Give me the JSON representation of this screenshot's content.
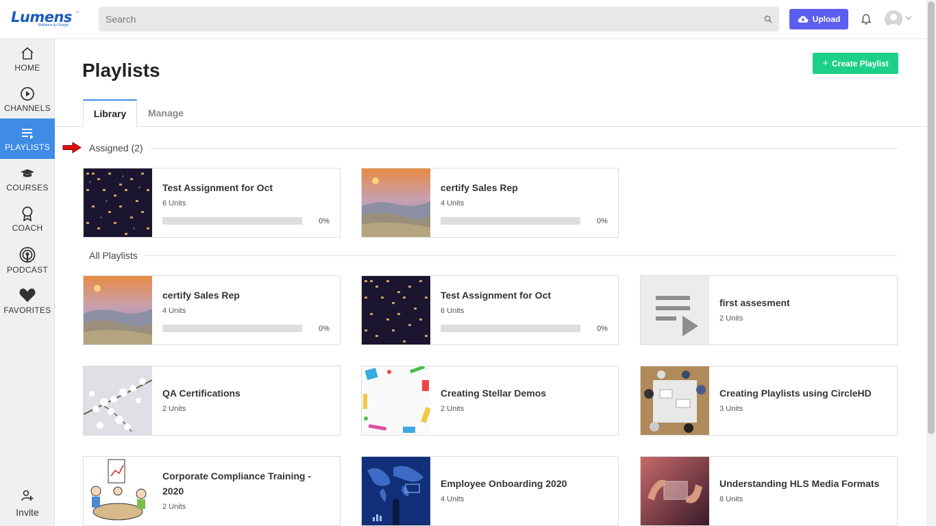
{
  "header": {
    "logo_text": "Lumens",
    "logo_tagline": "Brilliance by Design",
    "logo_tm": "™",
    "search_placeholder": "Search",
    "upload_label": "Upload"
  },
  "sidebar": {
    "items": [
      {
        "label": "HOME",
        "icon": "home-icon"
      },
      {
        "label": "CHANNELS",
        "icon": "play-circle-icon"
      },
      {
        "label": "PLAYLISTS",
        "icon": "playlist-icon",
        "active": true
      },
      {
        "label": "COURSES",
        "icon": "graduation-cap-icon"
      },
      {
        "label": "COACH",
        "icon": "award-icon"
      },
      {
        "label": "PODCAST",
        "icon": "podcast-icon"
      },
      {
        "label": "FAVORITES",
        "icon": "heart-icon"
      }
    ],
    "invite_label": "Invite"
  },
  "page": {
    "title": "Playlists",
    "create_label": "Create Playlist",
    "tabs": [
      "Library",
      "Manage"
    ],
    "assigned_heading": "Assigned (2)",
    "all_heading": "All Playlists"
  },
  "assigned": [
    {
      "title": "Test Assignment for Oct",
      "units": "6 Units",
      "progress": 0,
      "progress_label": "0%",
      "thumb": "city-night"
    },
    {
      "title": "certify Sales Rep",
      "units": "4 Units",
      "progress": 0,
      "progress_label": "0%",
      "thumb": "sunset-hills"
    }
  ],
  "all_playlists": [
    {
      "title": "certify Sales Rep",
      "units": "4 Units",
      "progress": 0,
      "progress_label": "0%",
      "thumb": "sunset-hills"
    },
    {
      "title": "Test Assignment for Oct",
      "units": "6 Units",
      "progress": 0,
      "progress_label": "0%",
      "thumb": "city-night"
    },
    {
      "title": "first assesment",
      "units": "2 Units",
      "thumb": "playlist-placeholder"
    },
    {
      "title": "QA Certifications",
      "units": "2 Units",
      "thumb": "blossom"
    },
    {
      "title": "Creating Stellar Demos",
      "units": "2 Units",
      "thumb": "stationery"
    },
    {
      "title": "Creating Playlists using CircleHD",
      "units": "3 Units",
      "thumb": "meeting"
    },
    {
      "title": "Corporate Compliance Training - 2020",
      "units": "2 Units",
      "thumb": "cartoon-team"
    },
    {
      "title": "Employee Onboarding 2020",
      "units": "4 Units",
      "thumb": "world-map"
    },
    {
      "title": "Understanding HLS Media Formats",
      "units": "8 Units",
      "thumb": "hands-frame"
    }
  ],
  "colors": {
    "brand": "#1d5bbf",
    "active_nav": "#3f8be6",
    "upload": "#5b5ef0",
    "create": "#1dd089",
    "arrow": "#e01010"
  }
}
